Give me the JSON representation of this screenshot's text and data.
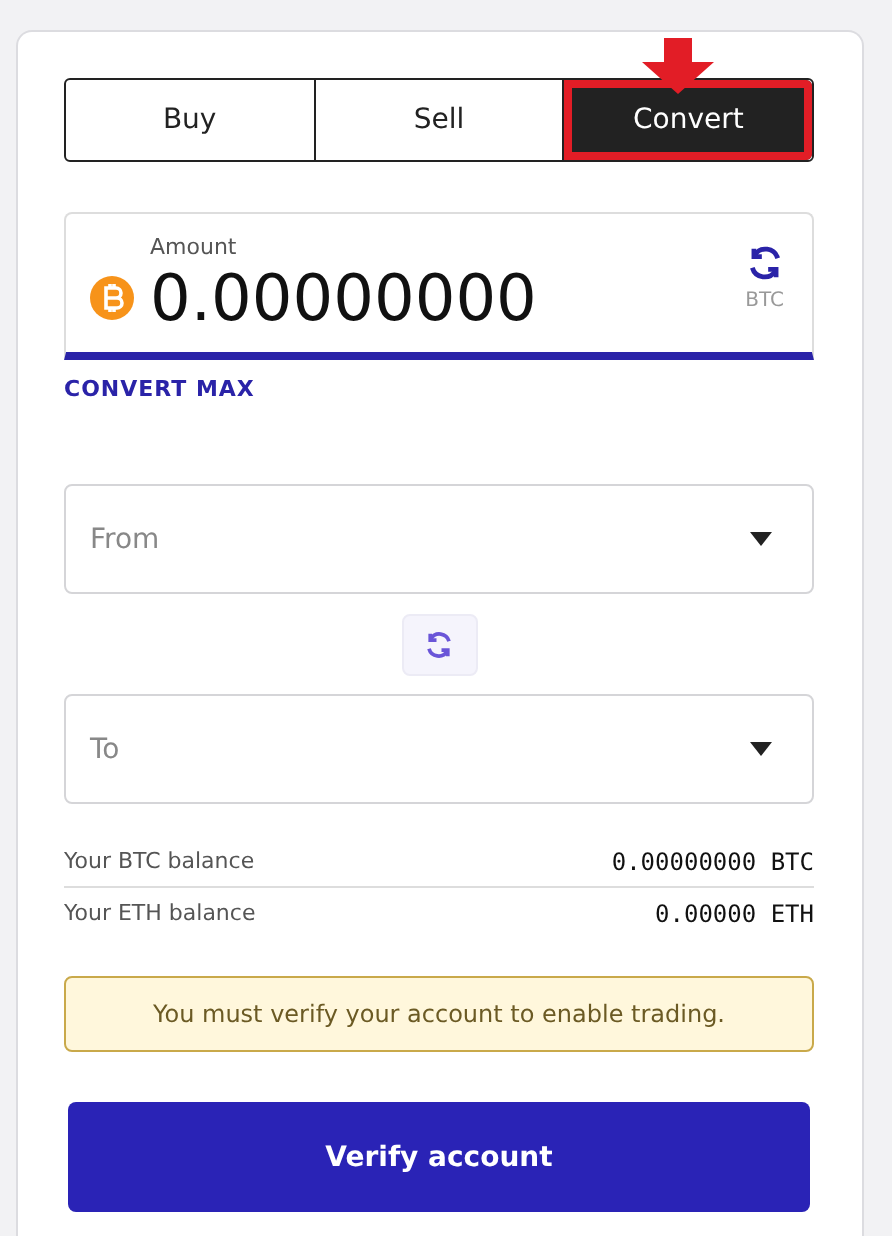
{
  "tabs": [
    {
      "label": "Buy",
      "selected": false,
      "highlighted": false
    },
    {
      "label": "Sell",
      "selected": false,
      "highlighted": false
    },
    {
      "label": "Convert",
      "selected": true,
      "highlighted": true
    }
  ],
  "amount": {
    "label": "Amount",
    "value": "0.00000000",
    "unit": "BTC"
  },
  "convert_max": "CONVERT MAX",
  "from": {
    "placeholder": "From"
  },
  "to": {
    "placeholder": "To"
  },
  "balances": [
    {
      "label": "Your BTC balance",
      "value": "0.00000000 BTC"
    },
    {
      "label": "Your ETH balance",
      "value": "0.00000 ETH"
    }
  ],
  "notice": "You must verify your account to enable trading.",
  "verify_button": "Verify account"
}
